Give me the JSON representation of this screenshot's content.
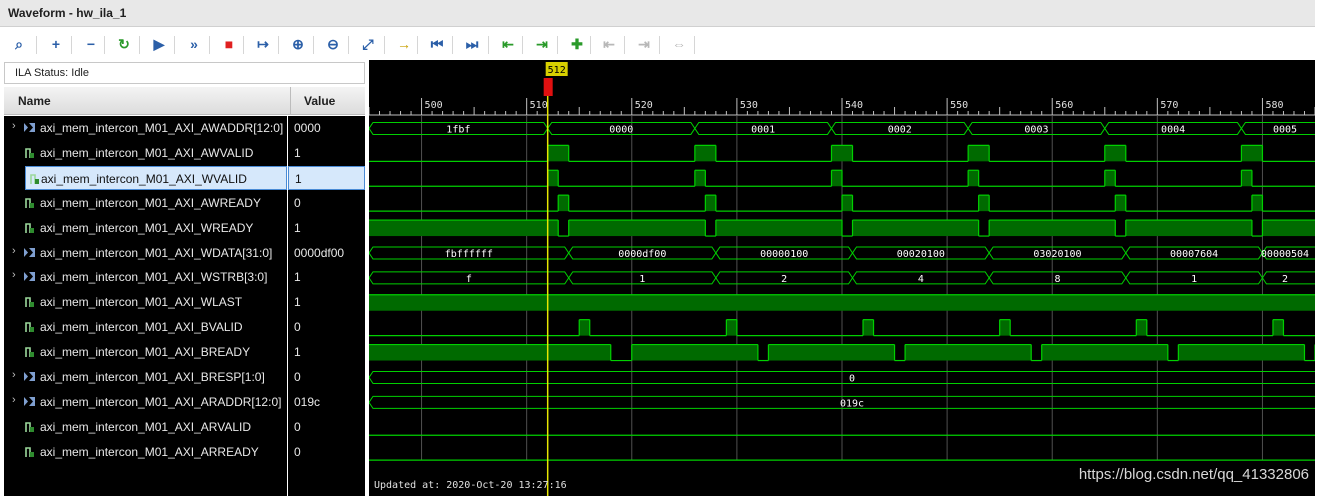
{
  "window": {
    "title": "Waveform - hw_ila_1"
  },
  "toolbar": {
    "buttons": [
      {
        "name": "search-icon",
        "glyph": "⌕",
        "color": "#2b5fa8"
      },
      {
        "name": "add-icon",
        "glyph": "+",
        "color": "#2b5fa8"
      },
      {
        "name": "remove-icon",
        "glyph": "−",
        "color": "#2b5fa8"
      },
      {
        "name": "run-trigger-immediate-icon",
        "glyph": "↻",
        "color": "#2a9a2a"
      },
      {
        "name": "run-trigger-icon",
        "glyph": "▶",
        "color": "#2b5fa8"
      },
      {
        "name": "run-continuous-icon",
        "glyph": "»",
        "color": "#2b5fa8"
      },
      {
        "name": "stop-icon",
        "glyph": "■",
        "color": "#e02020"
      },
      {
        "name": "export-icon",
        "glyph": "↦",
        "color": "#2b5fa8"
      },
      {
        "name": "zoom-in-icon",
        "glyph": "⊕",
        "color": "#2b5fa8"
      },
      {
        "name": "zoom-out-icon",
        "glyph": "⊖",
        "color": "#2b5fa8"
      },
      {
        "name": "zoom-fit-icon",
        "glyph": "⤢",
        "color": "#2b5fa8"
      },
      {
        "name": "go-to-cursor-icon",
        "glyph": "→",
        "color": "#c9a000"
      },
      {
        "name": "go-to-start-icon",
        "glyph": "⏮",
        "color": "#2b5fa8"
      },
      {
        "name": "go-to-end-icon",
        "glyph": "⏭",
        "color": "#2b5fa8"
      },
      {
        "name": "previous-transition-icon",
        "glyph": "⇤",
        "color": "#2a9a2a"
      },
      {
        "name": "next-transition-icon",
        "glyph": "⇥",
        "color": "#2a9a2a"
      },
      {
        "name": "add-marker-icon",
        "glyph": "✚",
        "color": "#2a9a2a"
      },
      {
        "name": "previous-marker-icon",
        "glyph": "⇤",
        "color": "#b8b8b8"
      },
      {
        "name": "next-marker-icon",
        "glyph": "⇥",
        "color": "#b8b8b8"
      },
      {
        "name": "swap-cursors-icon",
        "glyph": "⇔",
        "color": "#b8b8b8"
      }
    ]
  },
  "status": {
    "text": "ILA Status:  Idle"
  },
  "table": {
    "col_name": "Name",
    "col_value": "Value",
    "rows": [
      {
        "name": "axi_mem_intercon_M01_AXI_AWADDR[12:0]",
        "value": "0000",
        "bus": true
      },
      {
        "name": "axi_mem_intercon_M01_AXI_AWVALID",
        "value": "1",
        "bus": false
      },
      {
        "name": "axi_mem_intercon_M01_AXI_WVALID",
        "value": "1",
        "bus": false,
        "selected": true
      },
      {
        "name": "axi_mem_intercon_M01_AXI_AWREADY",
        "value": "0",
        "bus": false
      },
      {
        "name": "axi_mem_intercon_M01_AXI_WREADY",
        "value": "1",
        "bus": false
      },
      {
        "name": "axi_mem_intercon_M01_AXI_WDATA[31:0]",
        "value": "0000df00",
        "bus": true
      },
      {
        "name": "axi_mem_intercon_M01_AXI_WSTRB[3:0]",
        "value": "1",
        "bus": true
      },
      {
        "name": "axi_mem_intercon_M01_AXI_WLAST",
        "value": "1",
        "bus": false
      },
      {
        "name": "axi_mem_intercon_M01_AXI_BVALID",
        "value": "0",
        "bus": false
      },
      {
        "name": "axi_mem_intercon_M01_AXI_BREADY",
        "value": "1",
        "bus": false
      },
      {
        "name": "axi_mem_intercon_M01_AXI_BRESP[1:0]",
        "value": "0",
        "bus": true
      },
      {
        "name": "axi_mem_intercon_M01_AXI_ARADDR[12:0]",
        "value": "019c",
        "bus": true
      },
      {
        "name": "axi_mem_intercon_M01_AXI_ARVALID",
        "value": "0",
        "bus": false
      },
      {
        "name": "axi_mem_intercon_M01_AXI_ARREADY",
        "value": "0",
        "bus": false
      }
    ]
  },
  "timeline": {
    "start": 495,
    "end": 585,
    "major_ticks": [
      "500",
      "510",
      "520",
      "530",
      "540",
      "550",
      "560",
      "570",
      "580"
    ],
    "cursor": "512"
  },
  "waves": [
    {
      "type": "bus",
      "segments": [
        [
          495,
          "1fbf"
        ],
        [
          512,
          "0000"
        ],
        [
          526,
          "0001"
        ],
        [
          539,
          "0002"
        ],
        [
          552,
          "0003"
        ],
        [
          565,
          "0004"
        ],
        [
          578,
          "0005"
        ]
      ]
    },
    {
      "type": "bit",
      "init": 0,
      "high": [
        [
          512,
          514
        ],
        [
          526,
          528
        ],
        [
          539,
          541
        ],
        [
          552,
          554
        ],
        [
          565,
          567
        ],
        [
          578,
          580
        ]
      ]
    },
    {
      "type": "bit",
      "init": 0,
      "high": [
        [
          512,
          513
        ],
        [
          526,
          527
        ],
        [
          539,
          540
        ],
        [
          552,
          553
        ],
        [
          565,
          566
        ],
        [
          578,
          579
        ]
      ]
    },
    {
      "type": "bit",
      "init": 0,
      "high": [
        [
          513,
          514
        ],
        [
          527,
          528
        ],
        [
          540,
          541
        ],
        [
          553,
          554
        ],
        [
          566,
          567
        ],
        [
          579,
          580
        ]
      ]
    },
    {
      "type": "bit",
      "init": 1,
      "low": [
        [
          513,
          514
        ],
        [
          527,
          528
        ],
        [
          540,
          541
        ],
        [
          553,
          554
        ],
        [
          566,
          567
        ],
        [
          579,
          580
        ]
      ]
    },
    {
      "type": "bus",
      "segments": [
        [
          495,
          "fbffffff"
        ],
        [
          514,
          "0000df00"
        ],
        [
          528,
          "00000100"
        ],
        [
          541,
          "00020100"
        ],
        [
          554,
          "03020100"
        ],
        [
          567,
          "00007604"
        ],
        [
          580,
          "00000504"
        ]
      ]
    },
    {
      "type": "bus",
      "segments": [
        [
          495,
          "f"
        ],
        [
          514,
          "1"
        ],
        [
          528,
          "2"
        ],
        [
          541,
          "4"
        ],
        [
          554,
          "8"
        ],
        [
          567,
          "1"
        ],
        [
          580,
          "2"
        ]
      ]
    },
    {
      "type": "bit",
      "init": 1,
      "low": []
    },
    {
      "type": "bit",
      "init": 0,
      "high": [
        [
          515,
          516
        ],
        [
          529,
          530
        ],
        [
          542,
          543
        ],
        [
          555,
          556
        ],
        [
          568,
          569
        ],
        [
          581,
          582
        ]
      ]
    },
    {
      "type": "bit",
      "init": 1,
      "low": [
        [
          518,
          520
        ],
        [
          532,
          533
        ],
        [
          545,
          546
        ],
        [
          558,
          559
        ],
        [
          571,
          572
        ],
        [
          584,
          585
        ]
      ]
    },
    {
      "type": "bus",
      "segments": [
        [
          495,
          "0"
        ]
      ]
    },
    {
      "type": "bus",
      "segments": [
        [
          495,
          "019c"
        ]
      ]
    },
    {
      "type": "bit",
      "init": 0,
      "high": []
    },
    {
      "type": "bit",
      "init": 0,
      "high": []
    }
  ],
  "footer": {
    "updated": "Updated at: 2020-Oct-20 13:27:16",
    "watermark": "https://blog.csdn.net/qq_41332806"
  },
  "colors": {
    "wave": "#00d000",
    "wave_fill": "#006a00",
    "grid": "#505050",
    "cursor": "#e6e600",
    "cursor_marker": "#e01010",
    "bus_text": "#ffffff"
  }
}
